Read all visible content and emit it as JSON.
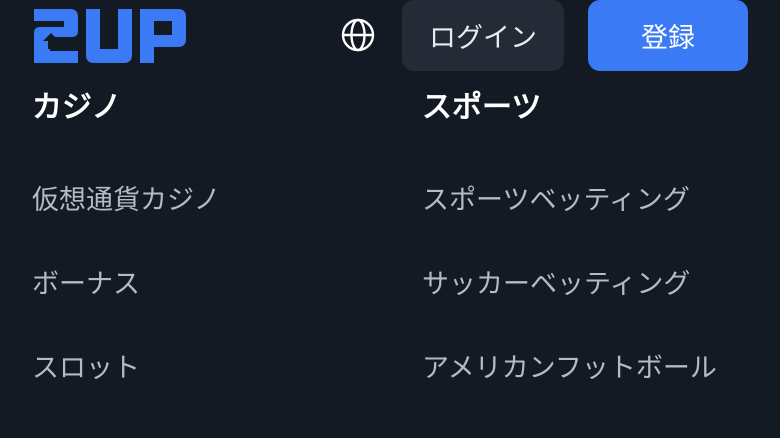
{
  "header": {
    "logo_text": "2UP",
    "language_icon": "globe-icon",
    "login_label": "ログイン",
    "register_label": "登録"
  },
  "colors": {
    "background": "#131a24",
    "brand_blue": "#3a7af5",
    "login_button_bg": "#242b36"
  },
  "menu": {
    "casino": {
      "heading": "カジノ",
      "items": [
        {
          "label": "仮想通貨カジノ"
        },
        {
          "label": "ボーナス"
        },
        {
          "label": "スロット"
        }
      ]
    },
    "sports": {
      "heading": "スポーツ",
      "items": [
        {
          "label": "スポーツベッティング"
        },
        {
          "label": "サッカーベッティング"
        },
        {
          "label": "アメリカンフットボール"
        }
      ]
    }
  }
}
